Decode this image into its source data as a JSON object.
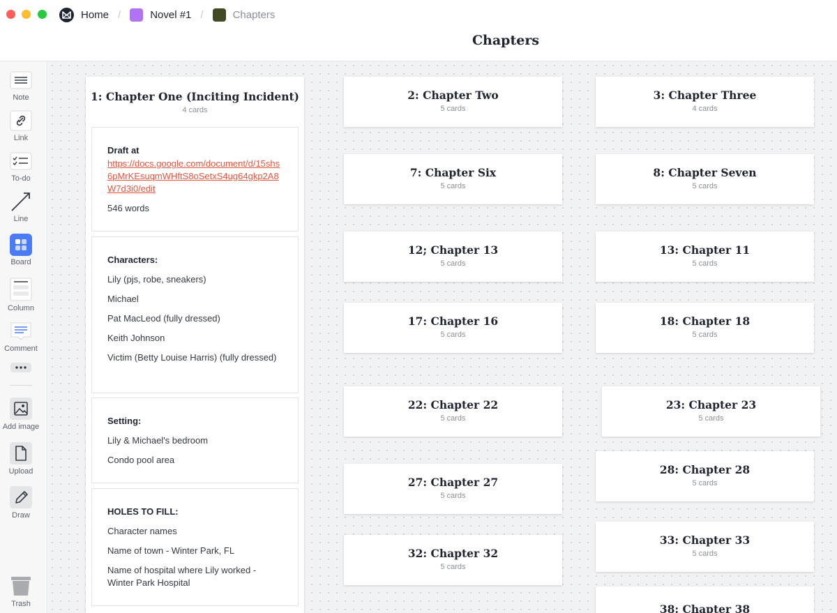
{
  "window": {
    "breadcrumbs": [
      {
        "label": "Home",
        "icon": "milanote-logo-icon",
        "color": "#1f2430"
      },
      {
        "label": "Novel #1",
        "icon": "board-square-icon",
        "color": "#b074f2"
      },
      {
        "label": "Chapters",
        "icon": "board-square-icon",
        "color": "#404a25"
      }
    ],
    "page_title": "Chapters"
  },
  "sidebar": {
    "tools": [
      {
        "label": "Note",
        "icon": "note-icon"
      },
      {
        "label": "Link",
        "icon": "link-icon"
      },
      {
        "label": "To-do",
        "icon": "todo-icon"
      },
      {
        "label": "Line",
        "icon": "line-arrow-icon"
      },
      {
        "label": "Board",
        "icon": "board-icon",
        "color": "#4a7cf7"
      },
      {
        "label": "Column",
        "icon": "column-icon"
      },
      {
        "label": "Comment",
        "icon": "comment-icon"
      },
      {
        "label": "",
        "icon": "more-icon"
      },
      {
        "label": "Add image",
        "icon": "image-icon"
      },
      {
        "label": "Upload",
        "icon": "upload-file-icon"
      },
      {
        "label": "Draw",
        "icon": "pencil-icon"
      },
      {
        "label": "Trash",
        "icon": "trash-icon"
      }
    ]
  },
  "column": {
    "title": "1: Chapter One (Inciting Incident)",
    "count": "4 cards",
    "cards": {
      "draft": {
        "heading": "Draft at",
        "link": "https://docs.google.com/document/d/15shs6pMrKEsuqmWHftS8oSetxS4ug64gkp2A8W7d3i0/edit",
        "words": "546 words"
      },
      "characters": {
        "heading": "Characters:",
        "items": [
          "Lily (pjs, robe, sneakers)",
          "Michael",
          "Pat MacLeod (fully dressed)",
          "Keith Johnson",
          "Victim (Betty Louise Harris) (fully dressed)"
        ]
      },
      "setting": {
        "heading": "Setting:",
        "items": [
          "Lily & Michael's bedroom",
          "Condo pool area"
        ]
      },
      "holes": {
        "heading": "HOLES TO FILL:",
        "items": [
          "Character names",
          "Name of town - Winter Park, FL",
          "Name of hospital where Lily worked - Winter Park Hospital"
        ]
      }
    }
  },
  "boards": [
    {
      "title": "2: Chapter Two",
      "count": "5 cards"
    },
    {
      "title": "3: Chapter Three",
      "count": "4 cards"
    },
    {
      "title": "7: Chapter Six",
      "count": "5 cards"
    },
    {
      "title": "8: Chapter Seven",
      "count": "5 cards"
    },
    {
      "title": "12; Chapter 13",
      "count": "5 cards"
    },
    {
      "title": "13: Chapter 11",
      "count": "5 cards"
    },
    {
      "title": "17: Chapter 16",
      "count": "5 cards"
    },
    {
      "title": "18: Chapter 18",
      "count": "5 cards"
    },
    {
      "title": "22: Chapter 22",
      "count": "5 cards"
    },
    {
      "title": "23: Chapter 23",
      "count": "5 cards"
    },
    {
      "title": "27: Chapter 27",
      "count": "5 cards"
    },
    {
      "title": "28: Chapter 28",
      "count": "5 cards"
    },
    {
      "title": "32: Chapter 32",
      "count": "5 cards"
    },
    {
      "title": "33: Chapter 33",
      "count": "5 cards"
    },
    {
      "title": "38: Chapter 38",
      "count": ""
    }
  ]
}
